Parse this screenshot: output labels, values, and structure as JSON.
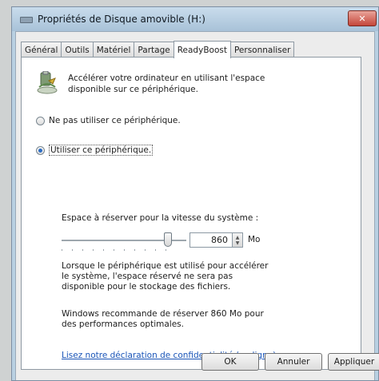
{
  "window": {
    "title": "Propriétés de Disque amovible (H:)",
    "close_symbol": "✕"
  },
  "tabs": [
    {
      "label": "Général"
    },
    {
      "label": "Outils"
    },
    {
      "label": "Matériel"
    },
    {
      "label": "Partage"
    },
    {
      "label": "ReadyBoost",
      "active": true
    },
    {
      "label": "Personnaliser"
    }
  ],
  "readyboost": {
    "intro": "Accélérer votre ordinateur en utilisant l'espace disponible sur ce périphérique.",
    "option_disable": "Ne pas utiliser ce périphérique.",
    "option_use": "Utiliser ce périphérique.",
    "selected_option": "use",
    "space_label": "Espace à réserver pour la vitesse du système :",
    "space_value": "860",
    "space_unit": "Mo",
    "info_reserved": "Lorsque le périphérique est utilisé pour accélérer le système, l'espace réservé ne sera pas disponible pour le stockage des fichiers.",
    "info_recommend": "Windows recommande de réserver 860 Mo pour des performances optimales.",
    "privacy_link": "Lisez notre déclaration de confidentialité (en ligne)"
  },
  "buttons": {
    "ok": "OK",
    "cancel": "Annuler",
    "apply": "Appliquer"
  },
  "icons": {
    "drive": "readyboost-drive-icon",
    "title": "removable-disk-icon"
  }
}
